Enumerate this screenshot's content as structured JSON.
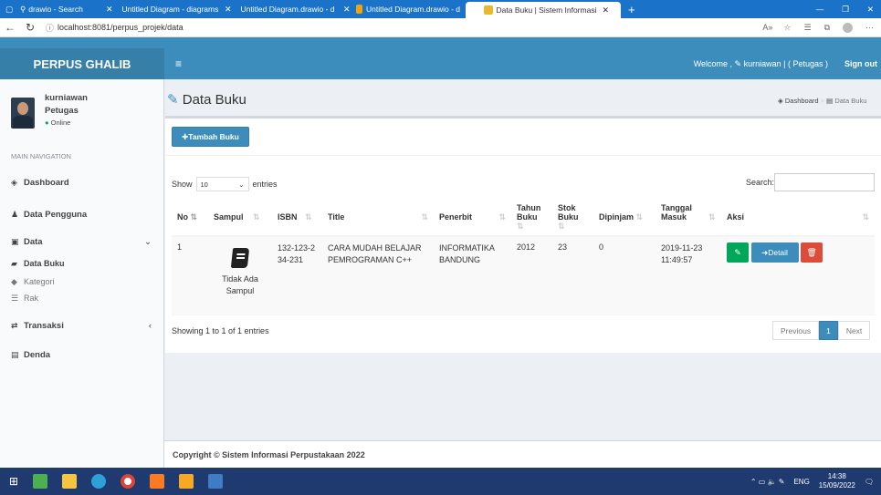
{
  "browser": {
    "tabs": [
      {
        "label": "drawio - Search",
        "fav": "Q"
      },
      {
        "label": "Untitled Diagram - diagrams.",
        "fav": "D"
      },
      {
        "label": "Untitled Diagram.drawio - d",
        "fav": "D"
      },
      {
        "label": "Untitled Diagram.drawio - d",
        "fav": "D"
      },
      {
        "label": "Data Buku | Sistem Informasi",
        "fav": "B"
      }
    ],
    "url": "localhost:8081/perpus_projek/data"
  },
  "app": {
    "logo": "PERPUS GHALIB",
    "welcome": "Welcome , ",
    "welcome_user": "kurniawan | ( Petugas )",
    "signout": "Sign out"
  },
  "sidebar": {
    "user_name": "kurniawan",
    "user_role": "Petugas",
    "status": "Online",
    "nav_header": "MAIN NAVIGATION",
    "dashboard": "Dashboard",
    "pengguna": "Data Pengguna",
    "data": "Data",
    "data_buku": "Data Buku",
    "kategori": "Kategori",
    "rak": "Rak",
    "transaksi": "Transaksi",
    "denda": "Denda"
  },
  "page": {
    "title": "Data Buku",
    "crumb_home": "Dashboard",
    "crumb_current": "Data Buku",
    "add_button": "Tambah Buku",
    "show": "Show",
    "entries_value": "10",
    "entries": "entries",
    "search": "Search:",
    "showing": "Showing 1 to 1 of 1 entries",
    "prev": "Previous",
    "page_num": "1",
    "next": "Next"
  },
  "table": {
    "headers": [
      "No",
      "Sampul",
      "ISBN",
      "Title",
      "Penerbit",
      "Tahun Buku",
      "Stok Buku",
      "Dipinjam",
      "Tanggal Masuk",
      "Aksi"
    ],
    "row": {
      "no": "1",
      "sampul_text": "Tidak Ada Sampul",
      "isbn": "132-123-234-231",
      "title": "CARA MUDAH BELAJAR PEMROGRAMAN C++",
      "penerbit": "INFORMATIKA BANDUNG",
      "tahun": "2012",
      "stok": "23",
      "dipinjam": "0",
      "tanggal": "2019-11-23 11:49:57",
      "detail": "Detail"
    }
  },
  "footer": "Copyright © Sistem Informasi Perpustakaan 2022",
  "taskbar": {
    "lang": "ENG",
    "time": "14:38",
    "date": "15/09/2022"
  }
}
